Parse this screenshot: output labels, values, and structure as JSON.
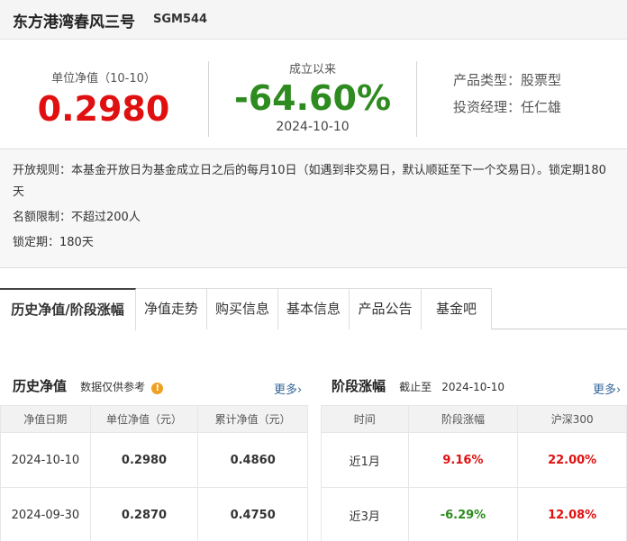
{
  "header": {
    "fund_name": "东方港湾春风三号",
    "code": "SGM544"
  },
  "summary": {
    "nav_label": "单位净值（10-10）",
    "nav_value": "0.2980",
    "return_label": "成立以来",
    "return_value": "-64.60%",
    "return_date": "2024-10-10",
    "product_type": "产品类型：股票型",
    "manager": "投资经理：任仁雄",
    "colors": {
      "up": "#e01010",
      "down": "#2e8b1f"
    }
  },
  "rules": {
    "open_rule": "开放规则：本基金开放日为基金成立日之后的每月10日（如遇到非交易日，默认顺延至下一个交易日）。锁定期180天",
    "quota": "名额限制：不超过200人",
    "lock": "锁定期：180天"
  },
  "tabs": [
    "历史净值/阶段涨幅",
    "净值走势",
    "购买信息",
    "基本信息",
    "产品公告",
    "基金吧"
  ],
  "history": {
    "title": "历史净值",
    "note": "数据仅供参考",
    "more": "更多",
    "more_arrow": "›",
    "columns": [
      "净值日期",
      "单位净值（元）",
      "累计净值（元）"
    ],
    "rows": [
      [
        "2024-10-10",
        "0.2980",
        "0.4860"
      ],
      [
        "2024-09-30",
        "0.2870",
        "0.4750"
      ]
    ]
  },
  "stage": {
    "title": "阶段涨幅",
    "as_of": "截止至",
    "date": "2024-10-10",
    "more": "更多",
    "more_arrow": "›",
    "columns": [
      "时间",
      "阶段涨幅",
      "沪深300"
    ],
    "rows": [
      [
        "近1月",
        "9.16%",
        "22.00%"
      ],
      [
        "近3月",
        "-6.29%",
        "12.08%"
      ]
    ]
  }
}
